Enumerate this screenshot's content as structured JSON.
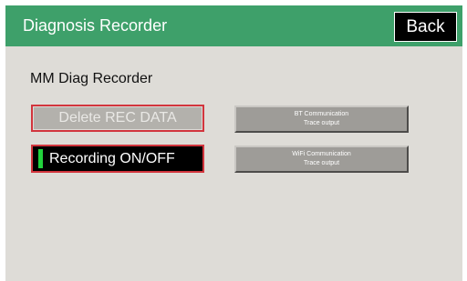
{
  "header": {
    "title": "Diagnosis Recorder",
    "back_label": "Back"
  },
  "main": {
    "section_title": "MM Diag Recorder",
    "delete_label": "Delete REC DATA",
    "recording_label": "Recording ON/OFF",
    "recording_state": "on",
    "bt_line1": "BT Communication",
    "bt_line2": "Trace output",
    "wifi_line1": "WiFi Communication",
    "wifi_line2": "Trace output"
  },
  "colors": {
    "header_bg": "#3ea06a",
    "screen_bg": "#dedcd7",
    "highlight_border": "#d2353d",
    "recording_indicator": "#22d23c"
  }
}
